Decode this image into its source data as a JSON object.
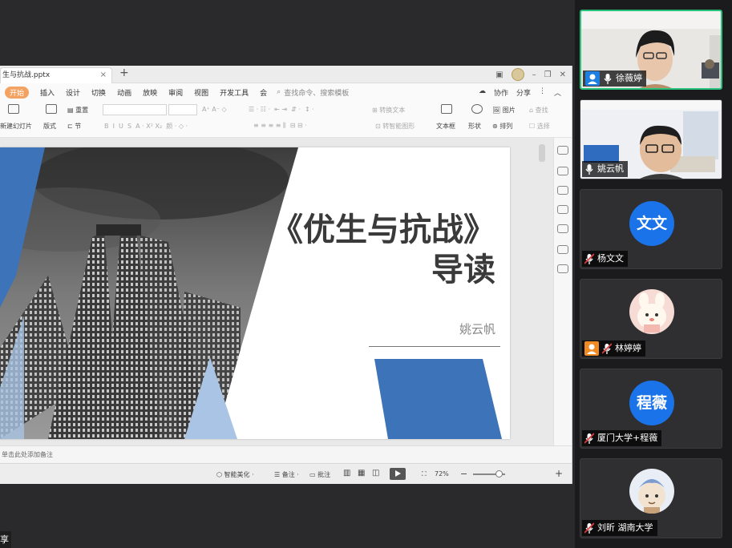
{
  "window": {
    "doc_tab": "生与抗战.pptx",
    "new_tab_symbol": "+",
    "close_symbol": "×"
  },
  "menu": {
    "items": [
      "开始",
      "插入",
      "设计",
      "切换",
      "动画",
      "放映",
      "审阅",
      "视图",
      "开发工具",
      "会"
    ],
    "search_placeholder": "查找命令、搜索模板",
    "right": [
      "协作",
      "分享"
    ]
  },
  "ribbon": {
    "new_slide": "新建幻灯片",
    "layout": "版式",
    "section": "节",
    "reset": "重置",
    "convert_text": "转换文本",
    "smart_graphic": "转智能图形",
    "textbox": "文本框",
    "shape": "形状",
    "picture": "图片",
    "arrange": "排列",
    "find": "查找",
    "select": "选择"
  },
  "slide": {
    "title_line1": "《优生与抗战》",
    "title_line2": "导读",
    "author": "姚云帆"
  },
  "notes_placeholder": "单击此处添加备注",
  "status": {
    "beautify": "智能美化",
    "notes": "备注",
    "comments": "批注",
    "zoom": "72%",
    "minus": "−",
    "plus": "+"
  },
  "share_label": "享",
  "participants": [
    {
      "name": "徐薇婷",
      "badge": "person",
      "mic": "on",
      "speaking": true,
      "avatar": "video"
    },
    {
      "name": "姚云帆",
      "badge": "",
      "mic": "on",
      "speaking": false,
      "avatar": "video"
    },
    {
      "name": "杨文文",
      "badge": "",
      "mic": "muted",
      "avatar_text": "文文",
      "avatar": "text"
    },
    {
      "name": "林婷婷",
      "badge": "person",
      "mic": "muted",
      "avatar": "cartoon"
    },
    {
      "name": "厦门大学+程薇",
      "badge": "",
      "mic": "muted",
      "avatar_text": "程薇",
      "avatar": "text"
    },
    {
      "name": "刘昕 湖南大学",
      "badge": "",
      "mic": "muted",
      "avatar": "cartoon"
    }
  ],
  "colors": {
    "accent_blue": "#3d73b8",
    "light_blue": "#a9c4e4",
    "avatar_blue": "#1a73e8",
    "speaking_green": "#27c27b",
    "menu_active": "#f4a261"
  }
}
